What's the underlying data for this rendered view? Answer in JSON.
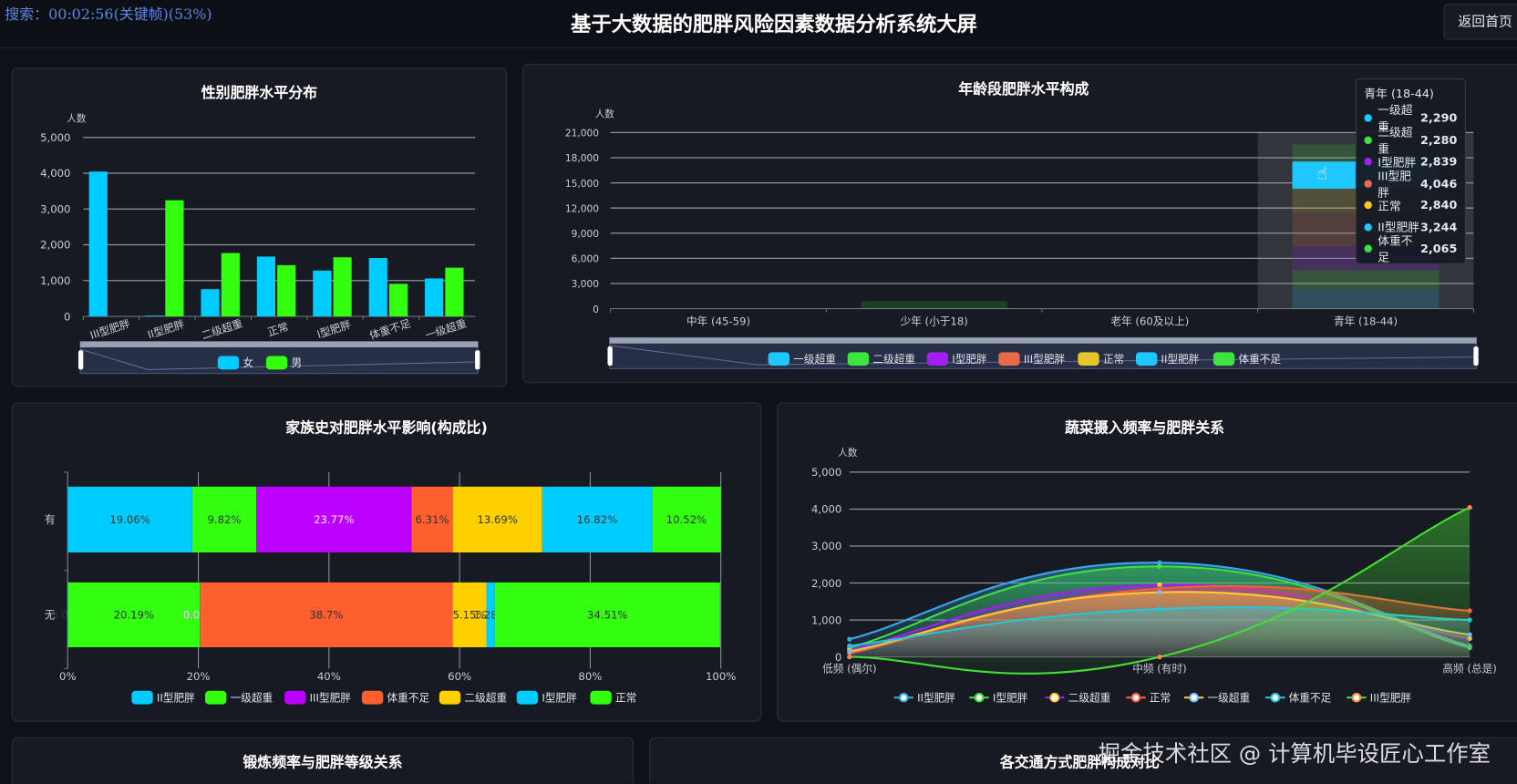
{
  "header": {
    "search_status": "搜索：00:02:56(关键帧)(53%)",
    "title": "基于大数据的肥胖风险因素数据分析系统大屏",
    "back_button": "返回首页"
  },
  "panels": {
    "exercise_title": "锻炼频率与肥胖等级关系",
    "transport_title": "各交通方式肥胖构成对比"
  },
  "watermark": "掘金技术社区 @ 计算机毕设匠心工作室",
  "chart_data": [
    {
      "type": "bar",
      "title": "性别肥胖水平分布",
      "ylabel": "人数",
      "xlabel": "",
      "ylim": [
        0,
        5000
      ],
      "yticks": [
        "0",
        "1,000",
        "2,000",
        "3,000",
        "4,000",
        "5,000"
      ],
      "grid": true,
      "legend_position": "bottom",
      "categories": [
        "III型肥胖",
        "II型肥胖",
        "二级超重",
        "正常",
        "I型肥胖",
        "体重不足",
        "一级超重"
      ],
      "series": [
        {
          "name": "女",
          "color": "#00ccff",
          "values": [
            4046,
            20,
            760,
            1670,
            1280,
            1630,
            1060
          ]
        },
        {
          "name": "男",
          "color": "#33ff11",
          "values": [
            0,
            3244,
            1770,
            1430,
            1650,
            910,
            1360
          ]
        }
      ]
    },
    {
      "type": "bar",
      "stacked": true,
      "title": "年龄段肥胖水平构成",
      "ylabel": "人数",
      "xlabel": "",
      "ylim": [
        0,
        21000
      ],
      "yticks": [
        "0",
        "3,000",
        "6,000",
        "9,000",
        "12,000",
        "15,000",
        "18,000",
        "21,000"
      ],
      "grid": true,
      "legend_position": "bottom",
      "categories": [
        "中年 (45-59)",
        "少年 (小于18)",
        "老年 (60及以上)",
        "青年 (18-44)"
      ],
      "highlighted_category": "青年 (18-44)",
      "series": [
        {
          "name": "一级超重",
          "color": "#1ec8ff",
          "values": [
            20,
            0,
            0,
            2290
          ]
        },
        {
          "name": "二级超重",
          "color": "#3de43d",
          "values": [
            20,
            0,
            0,
            2280
          ]
        },
        {
          "name": "I型肥胖",
          "color": "#a020f0",
          "values": [
            10,
            0,
            0,
            2839
          ]
        },
        {
          "name": "III型肥胖",
          "color": "#e86a4a",
          "values": [
            0,
            0,
            0,
            4046
          ]
        },
        {
          "name": "正常",
          "color": "#e6c62a",
          "values": [
            10,
            0,
            0,
            2840
          ]
        },
        {
          "name": "II型肥胖",
          "color": "#1ec8ff",
          "values": [
            0,
            0,
            0,
            3244
          ]
        },
        {
          "name": "体重不足",
          "color": "#3de43d",
          "values": [
            0,
            900,
            0,
            2065
          ]
        }
      ],
      "tooltip": {
        "title": "青年 (18-44)",
        "items": [
          {
            "name": "一级超重",
            "value": "2,290",
            "color": "#1ec8ff"
          },
          {
            "name": "二级超重",
            "value": "2,280",
            "color": "#3de43d"
          },
          {
            "name": "I型肥胖",
            "value": "2,839",
            "color": "#a020f0"
          },
          {
            "name": "III型肥胖",
            "value": "4,046",
            "color": "#e86a4a"
          },
          {
            "name": "正常",
            "value": "2,840",
            "color": "#ffc61a"
          },
          {
            "name": "II型肥胖",
            "value": "3,244",
            "color": "#1ec8ff"
          },
          {
            "name": "体重不足",
            "value": "2,065",
            "color": "#3de43d"
          }
        ]
      }
    },
    {
      "type": "bar",
      "orientation": "horizontal",
      "stacked": true,
      "title": "家族史对肥胖水平影响(构成比)",
      "xlim": [
        0,
        100
      ],
      "xticks": [
        "0%",
        "20%",
        "40%",
        "60%",
        "80%",
        "100%"
      ],
      "grid": true,
      "legend_position": "bottom",
      "categories": [
        "有",
        "无"
      ],
      "series": [
        {
          "name": "II型肥胖",
          "color": "#00ccff",
          "values": [
            19.06,
            0.03
          ],
          "labels": [
            "19.06%",
            "0.03%"
          ]
        },
        {
          "name": "一级超重",
          "color": "#33ff11",
          "values": [
            9.82,
            20.19
          ],
          "labels": [
            "9.82%",
            "20.19%"
          ]
        },
        {
          "name": "III型肥胖",
          "color": "#bb00ff",
          "values": [
            23.77,
            0.03
          ],
          "labels": [
            "23.77%",
            "0.03%"
          ]
        },
        {
          "name": "体重不足",
          "color": "#ff5f2e",
          "values": [
            6.31,
            38.7
          ],
          "labels": [
            "6.31%",
            "38.7%"
          ]
        },
        {
          "name": "二级超重",
          "color": "#ffd000",
          "values": [
            13.69,
            5.15
          ],
          "labels": [
            "13.69%",
            "5.15%"
          ]
        },
        {
          "name": "I型肥胖",
          "color": "#00ccff",
          "values": [
            16.82,
            1.28
          ],
          "labels": [
            "16.82%",
            "1.28%"
          ]
        },
        {
          "name": "正常",
          "color": "#33ff11",
          "values": [
            10.52,
            34.51
          ],
          "labels": [
            "10.52%",
            "34.51%"
          ]
        }
      ]
    },
    {
      "type": "line",
      "smooth": true,
      "area": true,
      "title": "蔬菜摄入频率与肥胖关系",
      "ylabel": "人数",
      "ylim": [
        0,
        5000
      ],
      "yticks": [
        "0",
        "1,000",
        "2,000",
        "3,000",
        "4,000",
        "5,000"
      ],
      "grid": true,
      "legend_position": "bottom",
      "categories": [
        "低频 (偶尔)",
        "中频 (有时)",
        "高频 (总是)"
      ],
      "series": [
        {
          "name": "II型肥胖",
          "color": "#3aa6e8",
          "marker": "#3aa6e8",
          "values": [
            480,
            2550,
            300
          ]
        },
        {
          "name": "I型肥胖",
          "color": "#3ee03e",
          "marker": "#3ee03e",
          "values": [
            250,
            2450,
            250
          ]
        },
        {
          "name": "二级超重",
          "color": "#a020f0",
          "marker": "#ffcc33",
          "values": [
            200,
            1950,
            500
          ]
        },
        {
          "name": "正常",
          "color": "#ff5a3c",
          "marker": "#ff5a3c",
          "values": [
            100,
            1850,
            1250
          ]
        },
        {
          "name": "一级超重",
          "color": "#ffc933",
          "marker": "#7fb8ff",
          "values": [
            150,
            1750,
            600
          ]
        },
        {
          "name": "体重不足",
          "color": "#26c6da",
          "marker": "#26c6da",
          "values": [
            300,
            1300,
            1000
          ]
        },
        {
          "name": "III型肥胖",
          "color": "#44dd33",
          "marker": "#ff8844",
          "values": [
            0,
            0,
            4046
          ]
        }
      ]
    }
  ]
}
